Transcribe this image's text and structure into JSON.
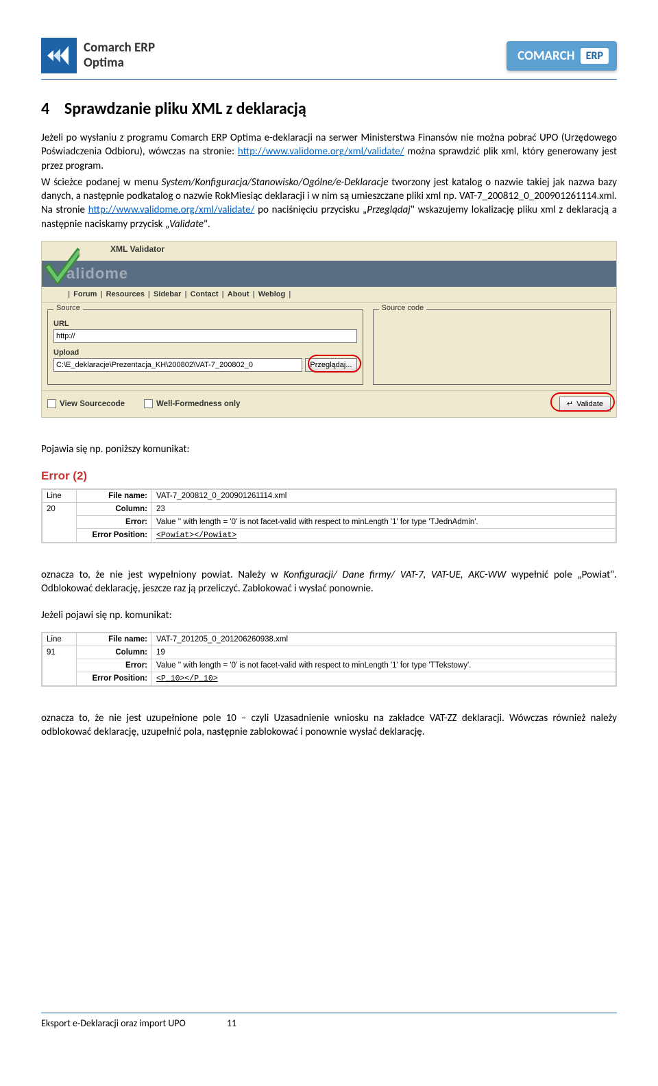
{
  "header": {
    "brand_left_line1": "Comarch ERP",
    "brand_left_line2": "Optima",
    "brand_right": "COMARCH",
    "brand_right_pill": "ERP"
  },
  "heading_num": "4",
  "heading_text": "Sprawdzanie pliku XML z deklaracją",
  "p1a": "Jeżeli po wysłaniu z programu Comarch ERP Optima e-deklaracji na serwer Ministerstwa Finansów nie można pobrać UPO (Urzędowego Poświadczenia Odbioru), wówczas na stronie: ",
  "p1_link": "http://www.validome.org/xml/validate/",
  "p1b": " można sprawdzić plik xml, który generowany jest przez program.",
  "p2a": "W ścieżce podanej w menu ",
  "p2_italic1": "System/Konfiguracja/Stanowisko/Ogólne/e-Deklaracje",
  "p2b": " tworzony jest katalog o nazwie takiej jak nazwa bazy danych, a następnie podkatalog o nazwie RokMiesiąc deklaracji i w nim są umieszczane pliki xml np. VAT-7_200812_0_200901261114.xml. Na stronie ",
  "p2_link": "http://www.validome.org/xml/validate/",
  "p2c": " po naciśnięciu przycisku „",
  "p2_italic2": "Przeglądaj",
  "p2d": "\" wskazujemy lokalizację pliku xml z deklaracją a następnie naciskamy przycisk „",
  "p2_italic3": "Validate",
  "p2e": "\".",
  "validator": {
    "title": "XML Validator",
    "brand": "alidome",
    "nav": [
      "Forum",
      "Resources",
      "Sidebar",
      "Contact",
      "About",
      "Weblog"
    ],
    "source_legend": "Source",
    "sourcecode_legend": "Source code",
    "url_label": "URL",
    "url_value": "http://",
    "upload_label": "Upload",
    "upload_value": "C:\\E_deklaracje\\Prezentacja_KH\\200802\\VAT-7_200802_0",
    "browse": "Przeglądaj...",
    "view_source": "View Sourcecode",
    "wellformed": "Well-Formedness only",
    "validate": "Validate"
  },
  "p3": "Pojawia się np. poniższy komunikat:",
  "err1": {
    "head": "Error (2)",
    "line_h": "Line",
    "line_v": "20",
    "file_lbl": "File name:",
    "file_val": "VAT-7_200812_0_200901261114.xml",
    "col_lbl": "Column:",
    "col_val": "23",
    "err_lbl": "Error:",
    "err_val": "Value '' with length = '0' is not facet-valid with respect to minLength '1' for type 'TJednAdmin'.",
    "pos_lbl": "Error Position:",
    "pos_val": "<Powiat></Powiat>"
  },
  "p4a": "oznacza to, że nie jest wypełniony powiat. Należy w ",
  "p4_italic": "Konfiguracji/ Dane firmy/ VAT-7, VAT-UE, AKC-WW",
  "p4b": " wypełnić pole „Powiat\". Odblokować deklarację, jeszcze raz ją przeliczyć. Zablokować i wysłać ponownie.",
  "p5": "Jeżeli pojawi się np. komunikat:",
  "err2": {
    "line_h": "Line",
    "line_v": "91",
    "file_lbl": "File name:",
    "file_val": "VAT-7_201205_0_201206260938.xml",
    "col_lbl": "Column:",
    "col_val": "19",
    "err_lbl": "Error:",
    "err_val": "Value '' with length = '0' is not facet-valid with respect to minLength '1' for type 'TTekstowy'.",
    "pos_lbl": "Error Position:",
    "pos_val": "<P_10></P_10>"
  },
  "p6": "oznacza to, że nie jest uzupełnione pole 10 – czyli Uzasadnienie wniosku na zakładce VAT-ZZ deklaracji. Wówczas również należy odblokować deklarację, uzupełnić pola, następnie zablokować i ponownie wysłać deklarację.",
  "footer_left": "Eksport e-Deklaracji oraz import UPO",
  "footer_page": "11"
}
